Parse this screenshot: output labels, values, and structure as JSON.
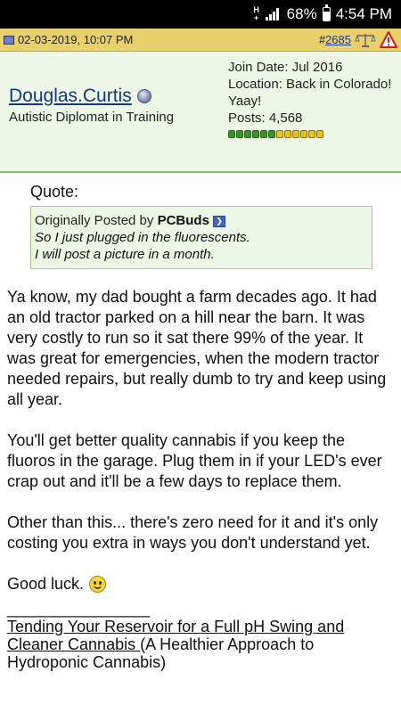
{
  "status_bar": {
    "network_letter": "H",
    "network_plus": "+",
    "battery": "68%",
    "time": "4:54 PM",
    "battery_level": 0.68
  },
  "post_header": {
    "date": "02-03-2019, 10:07 PM",
    "post_number_hash": "#",
    "post_number": "2685"
  },
  "user": {
    "name": "Douglas.Curtis",
    "title": "Autistic Diplomat in Training",
    "join_date": "Join Date: Jul 2016",
    "location": "Location: Back in Colorado! Yaay!",
    "posts": "Posts: 4,568",
    "reputation_bars": [
      "green",
      "green",
      "green",
      "green",
      "green",
      "green",
      "yellow",
      "yellow",
      "yellow",
      "yellow",
      "yellow",
      "yellow"
    ]
  },
  "quote": {
    "label": "Quote:",
    "prefix": "Originally Posted by ",
    "author": "PCBuds",
    "line1": "So I just plugged in the fluorescents.",
    "line2": "I will post a picture in a month."
  },
  "body": {
    "p1": "Ya know, my dad bought a farm decades ago. It had an old tractor parked on a hill near the barn. It was very costly to run so it sat there 99% of the year. It was great for emergencies, when the modern tractor needed repairs, but really dumb to try and keep using all year.",
    "p2": "You'll get better quality cannabis if you keep the fluoros in the garage. Plug them in if your LED's ever crap out and it'll be a few days to replace them.",
    "p3": "Other than this... there's zero need for it and it's only costing you extra in ways you don't understand yet.",
    "good_luck": "Good luck."
  },
  "signature": {
    "rule": "________________",
    "link_text": "Tending Your Reservoir for a Full pH Swing and Cleaner Cannabis ",
    "rest": "(A Healthier Approach to Hydroponic Cannabis)"
  }
}
